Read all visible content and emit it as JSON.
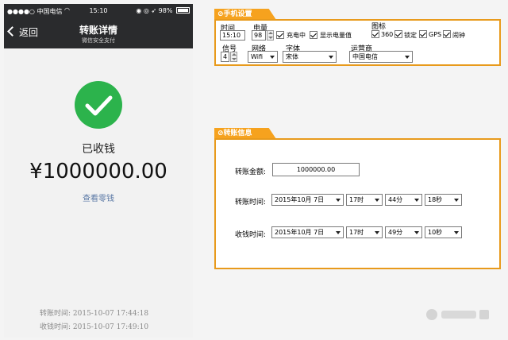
{
  "phone": {
    "statusbar": {
      "carrier": "●●●●○ 中国电信",
      "time": "15:10",
      "battery": "98%",
      "battery_level": 0.98
    },
    "navbar": {
      "back_label": "返回",
      "title": "转账详情",
      "subtitle": "微信安全支付"
    },
    "status_text": "已收钱",
    "amount": "¥1000000.00",
    "change_link": "查看零钱",
    "transfer_time": "转账时间: 2015-10-07 17:44:18",
    "receive_time": "收钱时间: 2015-10-07 17:49:10"
  },
  "phone_settings": {
    "tab_title": "手机设置",
    "time": {
      "label": "时间",
      "value": "15:10"
    },
    "battery": {
      "label": "电量",
      "value": "98",
      "charging_label": "充电中",
      "show_level_label": "显示电量值"
    },
    "icons": {
      "label": "图标",
      "items": [
        "360",
        "锁定",
        "GPS",
        "闹钟"
      ]
    },
    "signal": {
      "label": "信号",
      "value": "4"
    },
    "network": {
      "label": "网络",
      "value": "Wifi"
    },
    "font": {
      "label": "字体",
      "value": "宋体"
    },
    "operator": {
      "label": "运营商",
      "value": "中国电信"
    }
  },
  "transfer_info": {
    "tab_title": "转账信息",
    "amount_label": "转账金额:",
    "amount_value": "1000000.00",
    "transfer_time": {
      "label": "转账时间:",
      "date": "2015年10月 7日",
      "hour": "17时",
      "minute": "44分",
      "second": "18秒"
    },
    "receive_time": {
      "label": "收钱时间:",
      "date": "2015年10月 7日",
      "hour": "17时",
      "minute": "49分",
      "second": "10秒"
    }
  },
  "colors": {
    "accent": "#f6a21e",
    "panel_border": "#e89a1c",
    "success": "#2cb34c",
    "navbar": "#2a2b2d",
    "link": "#5a78a5"
  }
}
